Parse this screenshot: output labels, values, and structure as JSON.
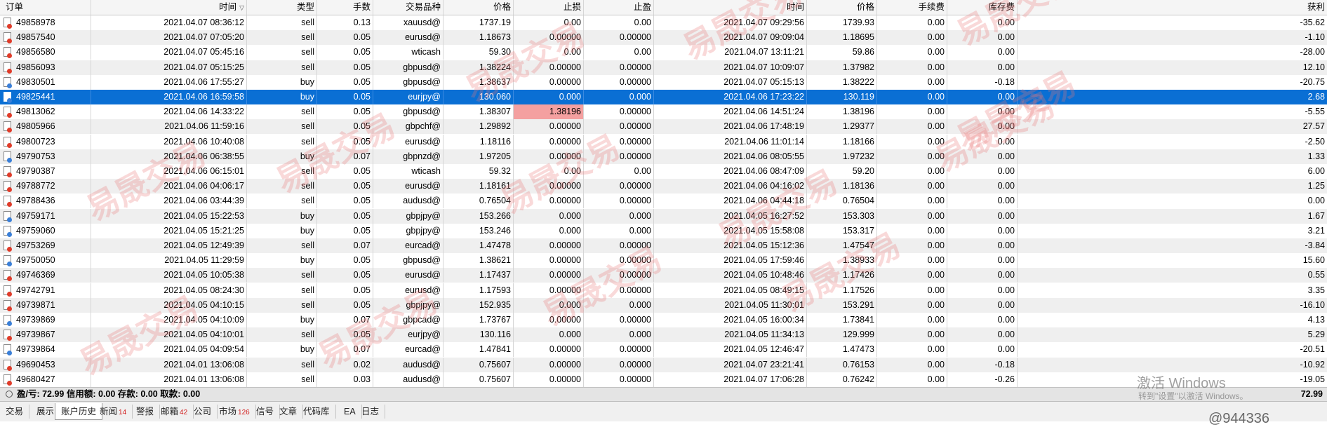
{
  "headers": {
    "order": "订单",
    "time": "时间",
    "type": "类型",
    "lots": "手数",
    "symbol": "交易品种",
    "price": "价格",
    "sl": "止损",
    "tp": "止盈",
    "close_time": "时间",
    "close_price": "价格",
    "commission": "手续费",
    "swap": "库存费",
    "profit": "获利"
  },
  "rows": [
    {
      "order": "49858978",
      "time": "2021.04.07 08:36:12",
      "type": "sell",
      "lots": "0.13",
      "symbol": "xauusd@",
      "price": "1737.19",
      "sl": "0.00",
      "tp": "0.00",
      "close_time": "2021.04.07 09:29:56",
      "close_price": "1739.93",
      "commission": "0.00",
      "swap": "0.00",
      "profit": "-35.62"
    },
    {
      "order": "49857540",
      "time": "2021.04.07 07:05:20",
      "type": "sell",
      "lots": "0.05",
      "symbol": "eurusd@",
      "price": "1.18673",
      "sl": "0.00000",
      "tp": "0.00000",
      "close_time": "2021.04.07 09:09:04",
      "close_price": "1.18695",
      "commission": "0.00",
      "swap": "0.00",
      "profit": "-1.10"
    },
    {
      "order": "49856580",
      "time": "2021.04.07 05:45:16",
      "type": "sell",
      "lots": "0.05",
      "symbol": "wticash",
      "price": "59.30",
      "sl": "0.00",
      "tp": "0.00",
      "close_time": "2021.04.07 13:11:21",
      "close_price": "59.86",
      "commission": "0.00",
      "swap": "0.00",
      "profit": "-28.00"
    },
    {
      "order": "49856093",
      "time": "2021.04.07 05:15:25",
      "type": "sell",
      "lots": "0.05",
      "symbol": "gbpusd@",
      "price": "1.38224",
      "sl": "0.00000",
      "tp": "0.00000",
      "close_time": "2021.04.07 10:09:07",
      "close_price": "1.37982",
      "commission": "0.00",
      "swap": "0.00",
      "profit": "12.10"
    },
    {
      "order": "49830501",
      "time": "2021.04.06 17:55:27",
      "type": "buy",
      "lots": "0.05",
      "symbol": "gbpusd@",
      "price": "1.38637",
      "sl": "0.00000",
      "tp": "0.00000",
      "close_time": "2021.04.07 05:15:13",
      "close_price": "1.38222",
      "commission": "0.00",
      "swap": "-0.18",
      "profit": "-20.75"
    },
    {
      "order": "49825441",
      "time": "2021.04.06 16:59:58",
      "type": "buy",
      "lots": "0.05",
      "symbol": "eurjpy@",
      "price": "130.060",
      "sl": "0.000",
      "tp": "0.000",
      "close_time": "2021.04.06 17:23:22",
      "close_price": "130.119",
      "commission": "0.00",
      "swap": "0.00",
      "profit": "2.68",
      "selected": true
    },
    {
      "order": "49813062",
      "time": "2021.04.06 14:33:22",
      "type": "sell",
      "lots": "0.05",
      "symbol": "gbpusd@",
      "price": "1.38307",
      "sl": "1.38196",
      "tp": "0.00000",
      "close_time": "2021.04.06 14:51:24",
      "close_price": "1.38196",
      "commission": "0.00",
      "swap": "0.00",
      "profit": "-5.55",
      "sl_hit": true
    },
    {
      "order": "49805966",
      "time": "2021.04.06 11:59:16",
      "type": "sell",
      "lots": "0.05",
      "symbol": "gbpchf@",
      "price": "1.29892",
      "sl": "0.00000",
      "tp": "0.00000",
      "close_time": "2021.04.06 17:48:19",
      "close_price": "1.29377",
      "commission": "0.00",
      "swap": "0.00",
      "profit": "27.57"
    },
    {
      "order": "49800723",
      "time": "2021.04.06 10:40:08",
      "type": "sell",
      "lots": "0.05",
      "symbol": "eurusd@",
      "price": "1.18116",
      "sl": "0.00000",
      "tp": "0.00000",
      "close_time": "2021.04.06 11:01:14",
      "close_price": "1.18166",
      "commission": "0.00",
      "swap": "0.00",
      "profit": "-2.50"
    },
    {
      "order": "49790753",
      "time": "2021.04.06 06:38:55",
      "type": "buy",
      "lots": "0.07",
      "symbol": "gbpnzd@",
      "price": "1.97205",
      "sl": "0.00000",
      "tp": "0.00000",
      "close_time": "2021.04.06 08:05:55",
      "close_price": "1.97232",
      "commission": "0.00",
      "swap": "0.00",
      "profit": "1.33"
    },
    {
      "order": "49790387",
      "time": "2021.04.06 06:15:01",
      "type": "sell",
      "lots": "0.05",
      "symbol": "wticash",
      "price": "59.32",
      "sl": "0.00",
      "tp": "0.00",
      "close_time": "2021.04.06 08:47:09",
      "close_price": "59.20",
      "commission": "0.00",
      "swap": "0.00",
      "profit": "6.00"
    },
    {
      "order": "49788772",
      "time": "2021.04.06 04:06:17",
      "type": "sell",
      "lots": "0.05",
      "symbol": "eurusd@",
      "price": "1.18161",
      "sl": "0.00000",
      "tp": "0.00000",
      "close_time": "2021.04.06 04:16:02",
      "close_price": "1.18136",
      "commission": "0.00",
      "swap": "0.00",
      "profit": "1.25"
    },
    {
      "order": "49788436",
      "time": "2021.04.06 03:44:39",
      "type": "sell",
      "lots": "0.05",
      "symbol": "audusd@",
      "price": "0.76504",
      "sl": "0.00000",
      "tp": "0.00000",
      "close_time": "2021.04.06 04:44:18",
      "close_price": "0.76504",
      "commission": "0.00",
      "swap": "0.00",
      "profit": "0.00"
    },
    {
      "order": "49759171",
      "time": "2021.04.05 15:22:53",
      "type": "buy",
      "lots": "0.05",
      "symbol": "gbpjpy@",
      "price": "153.266",
      "sl": "0.000",
      "tp": "0.000",
      "close_time": "2021.04.05 16:27:52",
      "close_price": "153.303",
      "commission": "0.00",
      "swap": "0.00",
      "profit": "1.67"
    },
    {
      "order": "49759060",
      "time": "2021.04.05 15:21:25",
      "type": "buy",
      "lots": "0.05",
      "symbol": "gbpjpy@",
      "price": "153.246",
      "sl": "0.000",
      "tp": "0.000",
      "close_time": "2021.04.05 15:58:08",
      "close_price": "153.317",
      "commission": "0.00",
      "swap": "0.00",
      "profit": "3.21"
    },
    {
      "order": "49753269",
      "time": "2021.04.05 12:49:39",
      "type": "sell",
      "lots": "0.07",
      "symbol": "eurcad@",
      "price": "1.47478",
      "sl": "0.00000",
      "tp": "0.00000",
      "close_time": "2021.04.05 15:12:36",
      "close_price": "1.47547",
      "commission": "0.00",
      "swap": "0.00",
      "profit": "-3.84"
    },
    {
      "order": "49750050",
      "time": "2021.04.05 11:29:59",
      "type": "buy",
      "lots": "0.05",
      "symbol": "gbpusd@",
      "price": "1.38621",
      "sl": "0.00000",
      "tp": "0.00000",
      "close_time": "2021.04.05 17:59:46",
      "close_price": "1.38933",
      "commission": "0.00",
      "swap": "0.00",
      "profit": "15.60"
    },
    {
      "order": "49746369",
      "time": "2021.04.05 10:05:38",
      "type": "sell",
      "lots": "0.05",
      "symbol": "eurusd@",
      "price": "1.17437",
      "sl": "0.00000",
      "tp": "0.00000",
      "close_time": "2021.04.05 10:48:46",
      "close_price": "1.17426",
      "commission": "0.00",
      "swap": "0.00",
      "profit": "0.55"
    },
    {
      "order": "49742791",
      "time": "2021.04.05 08:24:30",
      "type": "sell",
      "lots": "0.05",
      "symbol": "eurusd@",
      "price": "1.17593",
      "sl": "0.00000",
      "tp": "0.00000",
      "close_time": "2021.04.05 08:49:15",
      "close_price": "1.17526",
      "commission": "0.00",
      "swap": "0.00",
      "profit": "3.35"
    },
    {
      "order": "49739871",
      "time": "2021.04.05 04:10:15",
      "type": "sell",
      "lots": "0.05",
      "symbol": "gbpjpy@",
      "price": "152.935",
      "sl": "0.000",
      "tp": "0.000",
      "close_time": "2021.04.05 11:30:01",
      "close_price": "153.291",
      "commission": "0.00",
      "swap": "0.00",
      "profit": "-16.10"
    },
    {
      "order": "49739869",
      "time": "2021.04.05 04:10:09",
      "type": "buy",
      "lots": "0.07",
      "symbol": "gbpcad@",
      "price": "1.73767",
      "sl": "0.00000",
      "tp": "0.00000",
      "close_time": "2021.04.05 16:00:34",
      "close_price": "1.73841",
      "commission": "0.00",
      "swap": "0.00",
      "profit": "4.13"
    },
    {
      "order": "49739867",
      "time": "2021.04.05 04:10:01",
      "type": "sell",
      "lots": "0.05",
      "symbol": "eurjpy@",
      "price": "130.116",
      "sl": "0.000",
      "tp": "0.000",
      "close_time": "2021.04.05 11:34:13",
      "close_price": "129.999",
      "commission": "0.00",
      "swap": "0.00",
      "profit": "5.29"
    },
    {
      "order": "49739864",
      "time": "2021.04.05 04:09:54",
      "type": "buy",
      "lots": "0.07",
      "symbol": "eurcad@",
      "price": "1.47841",
      "sl": "0.00000",
      "tp": "0.00000",
      "close_time": "2021.04.05 12:46:47",
      "close_price": "1.47473",
      "commission": "0.00",
      "swap": "0.00",
      "profit": "-20.51"
    },
    {
      "order": "49690453",
      "time": "2021.04.01 13:06:08",
      "type": "sell",
      "lots": "0.02",
      "symbol": "audusd@",
      "price": "0.75607",
      "sl": "0.00000",
      "tp": "0.00000",
      "close_time": "2021.04.07 23:21:41",
      "close_price": "0.76153",
      "commission": "0.00",
      "swap": "-0.18",
      "profit": "-10.92"
    },
    {
      "order": "49680427",
      "time": "2021.04.01 13:06:08",
      "type": "sell",
      "lots": "0.03",
      "symbol": "audusd@",
      "price": "0.75607",
      "sl": "0.00000",
      "tp": "0.00000",
      "close_time": "2021.04.07 17:06:28",
      "close_price": "0.76242",
      "commission": "0.00",
      "swap": "-0.26",
      "profit": "-19.05"
    }
  ],
  "summary": {
    "text": "盈/亏: 72.99  信用额: 0.00  存款: 0.00  取款: 0.00",
    "total": "72.99"
  },
  "tabs": [
    {
      "label": "交易",
      "badge": ""
    },
    {
      "label": "展示",
      "badge": ""
    },
    {
      "label": "账户历史",
      "badge": "",
      "active": true
    },
    {
      "label": "新闻",
      "badge": "14"
    },
    {
      "label": "警报",
      "badge": ""
    },
    {
      "label": "邮箱",
      "badge": "42"
    },
    {
      "label": "公司",
      "badge": ""
    },
    {
      "label": "市场",
      "badge": "126"
    },
    {
      "label": "信号",
      "badge": ""
    },
    {
      "label": "文章",
      "badge": ""
    },
    {
      "label": "代码库",
      "badge": ""
    },
    {
      "label": "EA",
      "badge": ""
    },
    {
      "label": "日志",
      "badge": ""
    }
  ],
  "watermark_text": "易晟交易",
  "windows_activation": {
    "title": "激活 Windows",
    "subtitle": "转到\"设置\"以激活 Windows。"
  },
  "handle": "@944336",
  "colors": {
    "selected": "#0a6fd4",
    "sl_hit": "#f4a0a0",
    "sell_icon": "#e03c2a",
    "buy_icon": "#3a7fd8"
  }
}
